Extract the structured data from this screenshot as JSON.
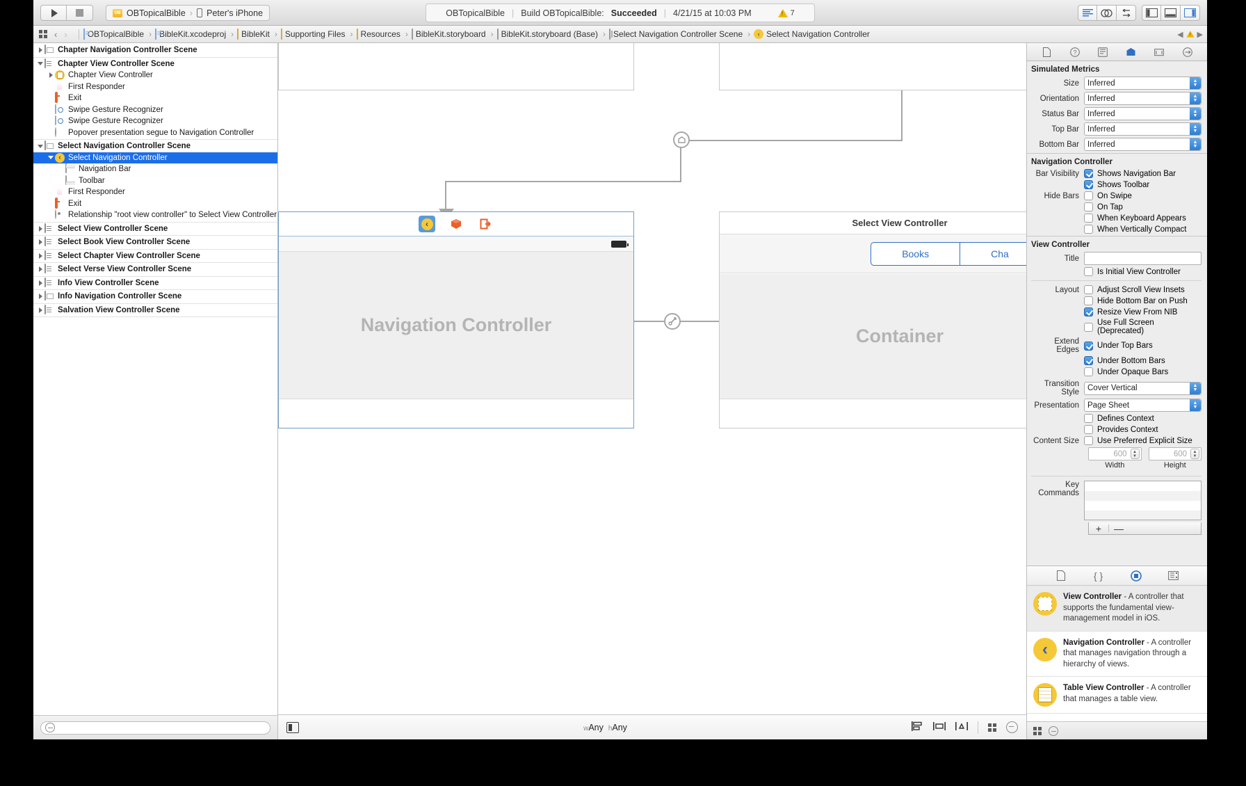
{
  "toolbar": {
    "run_label": "run-button",
    "stop_label": "stop-button",
    "scheme_project": "OBTopicalBible",
    "scheme_device": "Peter's iPhone",
    "status_project": "OBTopicalBible",
    "status_action": "Build OBTopicalBible:",
    "status_result": "Succeeded",
    "status_time": "4/21/15 at 10:03 PM",
    "warning_count": "7"
  },
  "jumpbar": {
    "crumbs": [
      {
        "label": "OBTopicalBible",
        "icon": "doc-icon"
      },
      {
        "label": "BibleKit.xcodeproj",
        "icon": "doc-icon"
      },
      {
        "label": "BibleKit",
        "icon": "folder-icon"
      },
      {
        "label": "Supporting Files",
        "icon": "folder-icon"
      },
      {
        "label": "Resources",
        "icon": "folder-icon"
      },
      {
        "label": "BibleKit.storyboard",
        "icon": "storyboard-icon"
      },
      {
        "label": "BibleKit.storyboard (Base)",
        "icon": "storyboard-icon"
      },
      {
        "label": "Select Navigation Controller Scene",
        "icon": "scene-icon"
      },
      {
        "label": "Select Navigation Controller",
        "icon": "nav-controller-icon"
      }
    ]
  },
  "navigator": {
    "rows": [
      {
        "label": "Chapter Navigation Controller Scene",
        "indent": 0,
        "bold": true,
        "disc": "closed",
        "icon": "scene-icon",
        "divider": true
      },
      {
        "label": "Chapter View Controller Scene",
        "indent": 0,
        "bold": true,
        "disc": "open",
        "icon": "tablevc-icon"
      },
      {
        "label": "Chapter View Controller",
        "indent": 1,
        "bold": false,
        "disc": "closed",
        "icon": "yellow-vc-icon"
      },
      {
        "label": "First Responder",
        "indent": 1,
        "bold": false,
        "disc": "none",
        "icon": "first-responder-icon"
      },
      {
        "label": "Exit",
        "indent": 1,
        "bold": false,
        "disc": "none",
        "icon": "exit-icon"
      },
      {
        "label": "Swipe Gesture Recognizer",
        "indent": 1,
        "bold": false,
        "disc": "none",
        "icon": "gesture-icon"
      },
      {
        "label": "Swipe Gesture Recognizer",
        "indent": 1,
        "bold": false,
        "disc": "none",
        "icon": "gesture-icon"
      },
      {
        "label": "Popover presentation segue to Navigation Controller",
        "indent": 1,
        "bold": false,
        "disc": "none",
        "icon": "segue-icon",
        "divider": true
      },
      {
        "label": "Select Navigation Controller Scene",
        "indent": 0,
        "bold": true,
        "disc": "open",
        "icon": "scene-icon"
      },
      {
        "label": "Select Navigation Controller",
        "indent": 1,
        "bold": false,
        "disc": "open",
        "icon": "nav-controller-icon",
        "selected": true
      },
      {
        "label": "Navigation Bar",
        "indent": 2,
        "bold": false,
        "disc": "none",
        "icon": "navbar-icon"
      },
      {
        "label": "Toolbar",
        "indent": 2,
        "bold": false,
        "disc": "none",
        "icon": "toolbar-icon"
      },
      {
        "label": "First Responder",
        "indent": 1,
        "bold": false,
        "disc": "none",
        "icon": "first-responder-icon"
      },
      {
        "label": "Exit",
        "indent": 1,
        "bold": false,
        "disc": "none",
        "icon": "exit-icon"
      },
      {
        "label": "Relationship \"root view controller\" to Select View Controller",
        "indent": 1,
        "bold": false,
        "disc": "none",
        "icon": "relationship-icon",
        "divider": true
      },
      {
        "label": "Select View Controller Scene",
        "indent": 0,
        "bold": true,
        "disc": "closed",
        "icon": "tablevc-icon",
        "divider": true
      },
      {
        "label": "Select Book View Controller Scene",
        "indent": 0,
        "bold": true,
        "disc": "closed",
        "icon": "tablevc-icon",
        "divider": true
      },
      {
        "label": "Select Chapter View Controller Scene",
        "indent": 0,
        "bold": true,
        "disc": "closed",
        "icon": "tablevc-icon",
        "divider": true
      },
      {
        "label": "Select Verse View Controller Scene",
        "indent": 0,
        "bold": true,
        "disc": "closed",
        "icon": "tablevc-icon",
        "divider": true
      },
      {
        "label": "Info View Controller Scene",
        "indent": 0,
        "bold": true,
        "disc": "closed",
        "icon": "tablevc-icon",
        "divider": true
      },
      {
        "label": "Info Navigation Controller Scene",
        "indent": 0,
        "bold": true,
        "disc": "closed",
        "icon": "scene-icon",
        "divider": true
      },
      {
        "label": "Salvation View Controller Scene",
        "indent": 0,
        "bold": true,
        "disc": "closed",
        "icon": "tablevc-icon",
        "divider": true
      }
    ],
    "filter_placeholder": ""
  },
  "canvas": {
    "nav_scene_label": "Navigation Controller",
    "select_scene_title": "Select View Controller",
    "select_scene_label": "Container",
    "segmented": [
      "Books",
      "Cha"
    ],
    "size_class_w_prefix": "w",
    "size_class_w": "Any",
    "size_class_h_prefix": "h",
    "size_class_h": "Any"
  },
  "inspector": {
    "tabs": [
      "file-inspector-icon",
      "quick-help-icon",
      "identity-inspector-icon",
      "attributes-inspector-icon",
      "size-inspector-icon",
      "connections-inspector-icon"
    ],
    "simulated_metrics": {
      "title": "Simulated Metrics",
      "fields": [
        {
          "label": "Size",
          "value": "Inferred"
        },
        {
          "label": "Orientation",
          "value": "Inferred"
        },
        {
          "label": "Status Bar",
          "value": "Inferred"
        },
        {
          "label": "Top Bar",
          "value": "Inferred"
        },
        {
          "label": "Bottom Bar",
          "value": "Inferred"
        }
      ]
    },
    "navigation_controller": {
      "title": "Navigation Controller",
      "bar_visibility_label": "Bar Visibility",
      "hide_bars_label": "Hide Bars",
      "checks": [
        {
          "label": "Shows Navigation Bar",
          "checked": true
        },
        {
          "label": "Shows Toolbar",
          "checked": true
        },
        {
          "label": "On Swipe",
          "checked": false
        },
        {
          "label": "On Tap",
          "checked": false
        },
        {
          "label": "When Keyboard Appears",
          "checked": false
        },
        {
          "label": "When Vertically Compact",
          "checked": false
        }
      ]
    },
    "view_controller": {
      "title": "View Controller",
      "title_label": "Title",
      "title_value": "",
      "is_initial_label": "Is Initial View Controller",
      "is_initial_checked": false,
      "layout_label": "Layout",
      "layout_checks": [
        {
          "label": "Adjust Scroll View Insets",
          "checked": false
        },
        {
          "label": "Hide Bottom Bar on Push",
          "checked": false
        },
        {
          "label": "Resize View From NIB",
          "checked": true
        },
        {
          "label": "Use Full Screen (Deprecated)",
          "checked": false
        }
      ],
      "extend_edges_label": "Extend Edges",
      "extend_checks": [
        {
          "label": "Under Top Bars",
          "checked": true
        },
        {
          "label": "Under Bottom Bars",
          "checked": true
        },
        {
          "label": "Under Opaque Bars",
          "checked": false
        }
      ],
      "transition_label": "Transition Style",
      "transition_value": "Cover Vertical",
      "presentation_label": "Presentation",
      "presentation_value": "Page Sheet",
      "context_checks": [
        {
          "label": "Defines Context",
          "checked": false
        },
        {
          "label": "Provides Context",
          "checked": false
        }
      ],
      "content_size_label": "Content Size",
      "content_size_check": "Use Preferred Explicit Size",
      "width_value": "600",
      "height_value": "600",
      "width_caption": "Width",
      "height_caption": "Height"
    },
    "key_commands": {
      "label": "Key Commands",
      "add": "+",
      "remove": "—"
    }
  },
  "library": {
    "tabs": [
      "file-template-library-icon",
      "code-snippet-library-icon",
      "object-library-icon",
      "media-library-icon"
    ],
    "items": [
      {
        "name": "View Controller",
        "desc": " - A controller that supports the fundamental view-management model in iOS.",
        "icon": "view-controller-icon",
        "highlighted": true
      },
      {
        "name": "Navigation Controller",
        "desc": " - A controller that manages navigation through a hierarchy of views.",
        "icon": "navigation-controller-icon",
        "highlighted": false
      },
      {
        "name": "Table View Controller",
        "desc": " - A controller that manages a table view.",
        "icon": "table-view-controller-icon",
        "highlighted": false
      }
    ]
  }
}
